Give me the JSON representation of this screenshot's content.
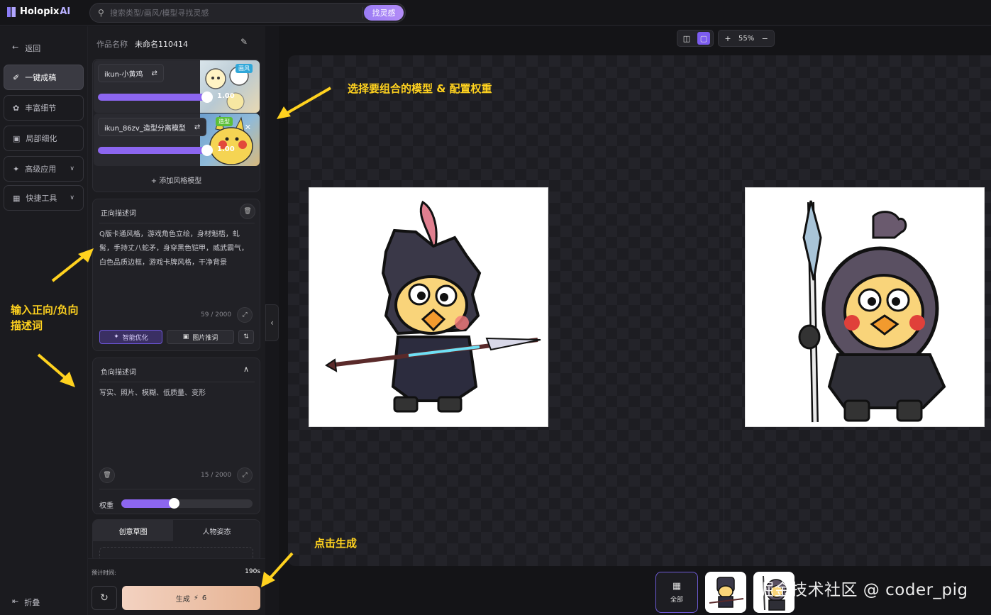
{
  "app": {
    "logo_text": "Holopix",
    "logo_suffix": "AI"
  },
  "search": {
    "placeholder": "搜索类型/画风/模型寻找灵感",
    "button": "找灵感"
  },
  "nav": {
    "back": "返回",
    "items": [
      {
        "label": "一键成稿",
        "active": true
      },
      {
        "label": "丰富细节"
      },
      {
        "label": "局部细化"
      },
      {
        "label": "高级应用",
        "has_menu": true
      },
      {
        "label": "快捷工具",
        "has_menu": true
      }
    ],
    "fold": "折叠"
  },
  "work": {
    "name_label": "作品名称",
    "name_value": "未命名110414"
  },
  "models": [
    {
      "name": "ikun-小黄鸡",
      "weight": 1.0,
      "weight_text": "1.00",
      "tag": "画风",
      "tag_color": "#2fa7d9"
    },
    {
      "name": "ikun_86zv_造型分离模型",
      "weight": 1.0,
      "weight_text": "1.00",
      "tag": "造型",
      "tag_color": "#5bbf39"
    }
  ],
  "add_model": "添加风格模型",
  "positive": {
    "title": "正向描述词",
    "text": "Q版卡通风格，游戏角色立绘，身材魁梧，虬髯，手持丈八蛇矛，身穿黑色铠甲，威武霸气，白色品质边框，游戏卡牌风格，干净背景",
    "count": "59",
    "max": "/ 2000",
    "smart_btn": "智能优化",
    "image_btn": "图片推词"
  },
  "negative": {
    "title": "负向描述词",
    "text": "写实、照片、模糊、低质量、变形",
    "count": "15",
    "max": "/ 2000",
    "weight_label": "权重",
    "weight_value": 0.4
  },
  "tabs": [
    "创意草图",
    "人物姿态"
  ],
  "generate": {
    "est_label": "预计时间:",
    "est_value": "190s",
    "button": "生成",
    "cost": "6"
  },
  "zoom": {
    "value": "55%"
  },
  "annotations": {
    "models": "选择要组合的模型 & 配置权重",
    "prompts_line1": "输入正向/负向",
    "prompts_line2": "描述词",
    "generate": "点击生成"
  },
  "bottom": {
    "all_label": "全部"
  },
  "watermark": "掘金技术社区 @ coder_pig",
  "colors": {
    "accent": "#8c66f0",
    "annotation": "#ffd21f",
    "generate_from": "#f3d2c1",
    "generate_to": "#e6b393"
  }
}
